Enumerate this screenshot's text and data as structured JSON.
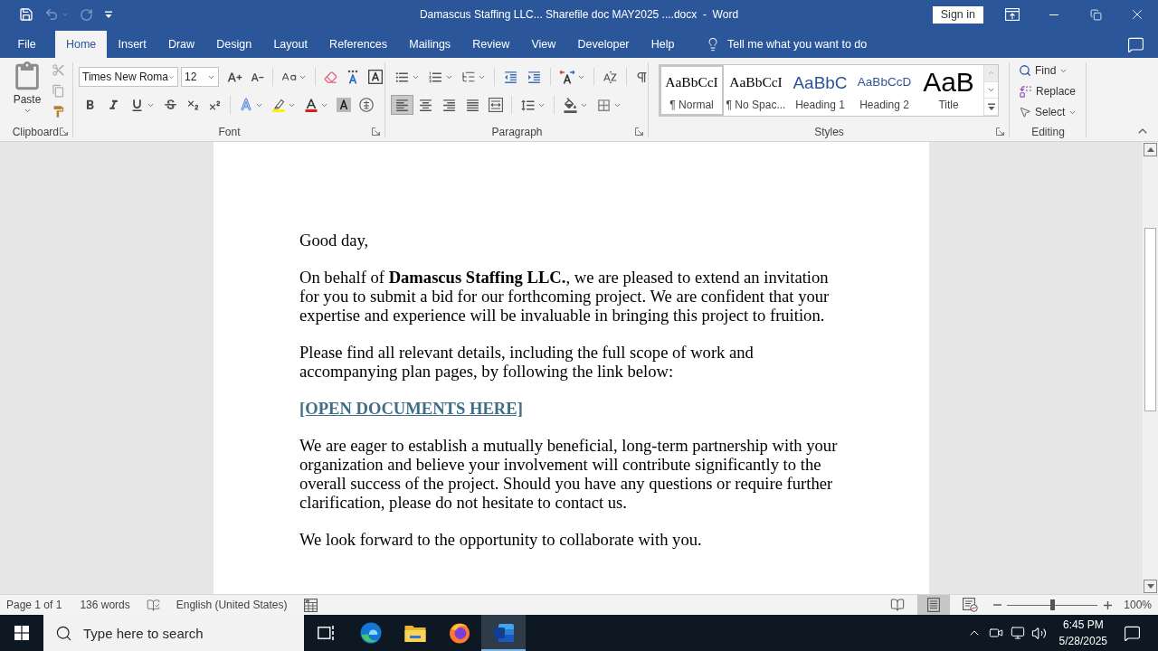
{
  "title_bar": {
    "quick_access": [
      {
        "kind": "save",
        "disabled": false
      },
      {
        "kind": "undo",
        "disabled": true
      },
      {
        "kind": "redo",
        "disabled": true
      },
      {
        "kind": "customize",
        "disabled": false
      }
    ],
    "title": "Damascus Staffing LLC... Sharefile doc MAY2025 ....docx  -  Word",
    "sign_in": "Sign in"
  },
  "menu_tabs": [
    {
      "label": "File",
      "selected": false
    },
    {
      "label": "Home",
      "selected": true
    },
    {
      "label": "Insert",
      "selected": false
    },
    {
      "label": "Draw",
      "selected": false
    },
    {
      "label": "Design",
      "selected": false
    },
    {
      "label": "Layout",
      "selected": false
    },
    {
      "label": "References",
      "selected": false
    },
    {
      "label": "Mailings",
      "selected": false
    },
    {
      "label": "Review",
      "selected": false
    },
    {
      "label": "View",
      "selected": false
    },
    {
      "label": "Developer",
      "selected": false
    },
    {
      "label": "Help",
      "selected": false
    }
  ],
  "tell_me": {
    "placeholder": "Tell me what you want to do"
  },
  "ribbon": {
    "clipboard": {
      "label": "Clipboard",
      "paste": "Paste",
      "tools": [
        {
          "kind": "cut",
          "disabled": true
        },
        {
          "kind": "copy",
          "disabled": true
        },
        {
          "kind": "format_painter",
          "disabled": false
        }
      ]
    },
    "font": {
      "label": "Font",
      "font_name": "Times New Roma",
      "font_size": "12"
    },
    "paragraph": {
      "label": "Paragraph",
      "alignment": [
        {
          "kind": "left",
          "selected": true
        },
        {
          "kind": "center",
          "selected": false
        },
        {
          "kind": "right",
          "selected": false
        },
        {
          "kind": "justify",
          "selected": false
        },
        {
          "kind": "distributed",
          "selected": false
        }
      ]
    },
    "styles": {
      "label": "Styles",
      "gallery": [
        {
          "kind": "normal",
          "preview": "AaBbCcI",
          "name": "¶ Normal",
          "selected": true
        },
        {
          "kind": "no_spacing",
          "preview": "AaBbCcI",
          "name": "¶ No Spac...",
          "selected": false
        },
        {
          "kind": "heading1",
          "preview": "AaBbC",
          "name": "Heading 1",
          "selected": false
        },
        {
          "kind": "heading2",
          "preview": "AaBbCcD",
          "name": "Heading 2",
          "selected": false
        },
        {
          "kind": "title",
          "preview": "AaB",
          "name": "Title",
          "selected": false
        }
      ]
    },
    "editing": {
      "label": "Editing",
      "find": "Find",
      "replace": "Replace",
      "select": "Select"
    }
  },
  "document": {
    "paragraphs": [
      {
        "kind": "text",
        "lines": [
          "Good day,"
        ]
      },
      {
        "kind": "text",
        "lines": [
          "On behalf of **Damascus Staffing LLC.**, we are pleased to extend an invitation",
          "for you to submit a bid for our forthcoming project. We are confident that your",
          "expertise and experience will be invaluable in bringing this project to fruition."
        ]
      },
      {
        "kind": "text",
        "lines": [
          "Please find all relevant details, including the full scope of work and",
          "accompanying plan pages, by following the link below:"
        ]
      },
      {
        "kind": "link",
        "lines": [
          "[OPEN DOCUMENTS HERE]"
        ]
      },
      {
        "kind": "text",
        "lines": [
          "We are eager to establish a mutually beneficial, long-term partnership with your",
          "organization and believe your involvement will contribute significantly to the",
          "overall success of the project. Should you have any questions or require further",
          "clarification, please do not hesitate to contact us."
        ]
      },
      {
        "kind": "text",
        "lines": [
          "We look forward to the opportunity to collaborate with you."
        ]
      }
    ]
  },
  "status_bar": {
    "page": "Page 1 of 1",
    "words": "136 words",
    "language": "English (United States)",
    "views": [
      {
        "kind": "read_mode",
        "selected": false
      },
      {
        "kind": "print_layout",
        "selected": true
      },
      {
        "kind": "web_layout",
        "selected": false
      }
    ],
    "zoom": {
      "level": 0.5,
      "reading": "100%"
    }
  },
  "taskbar": {
    "search": {
      "placeholder": "Type here to search"
    },
    "apps": [
      {
        "kind": "task_view",
        "selected": false
      },
      {
        "kind": "edge",
        "selected": false
      },
      {
        "kind": "file_explorer",
        "selected": false
      },
      {
        "kind": "firefox",
        "selected": false
      },
      {
        "kind": "word",
        "selected": true
      }
    ],
    "time": "6:45 PM",
    "date": "5/28/2025"
  }
}
